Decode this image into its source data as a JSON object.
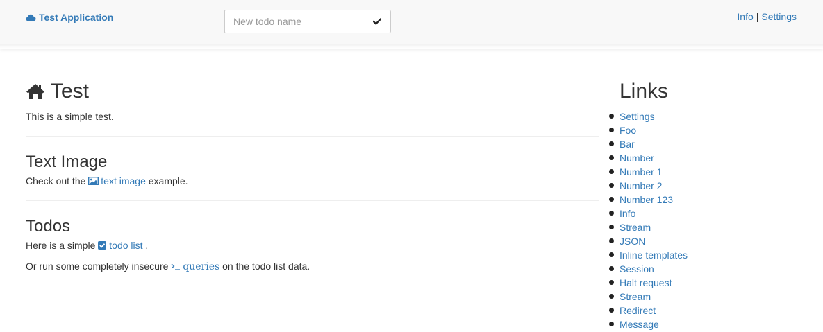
{
  "navbar": {
    "brand": "Test Application",
    "brand_icon": "cloud-icon",
    "todo_placeholder": "New todo name",
    "submit_icon": "check-icon",
    "links": [
      "Info",
      "Settings"
    ],
    "separator": "|"
  },
  "main": {
    "title": "Test",
    "title_icon": "home-icon",
    "intro": "This is a simple test.",
    "text_image": {
      "heading": "Text Image",
      "prefix": "Check out the",
      "link": "text image",
      "suffix": "example.",
      "icon": "picture-icon"
    },
    "todos": {
      "heading": "Todos",
      "line1_prefix": "Here is a simple",
      "line1_link": "todo list",
      "line1_suffix": ".",
      "line1_icon": "checkbox-icon",
      "line2_prefix": "Or run some completely insecure",
      "line2_link": "queries",
      "line2_suffix": "on the todo list data.",
      "line2_icon": "terminal-icon"
    }
  },
  "sidebar": {
    "title": "Links",
    "links": [
      "Settings",
      "Foo",
      "Bar",
      "Number",
      "Number 1",
      "Number 2",
      "Number 123",
      "Info",
      "Stream",
      "JSON",
      "Inline templates",
      "Session",
      "Halt request",
      "Stream",
      "Redirect",
      "Message"
    ]
  },
  "colors": {
    "link": "#337ab7",
    "text": "#333333",
    "navbar_bg": "#f8f8f8"
  }
}
